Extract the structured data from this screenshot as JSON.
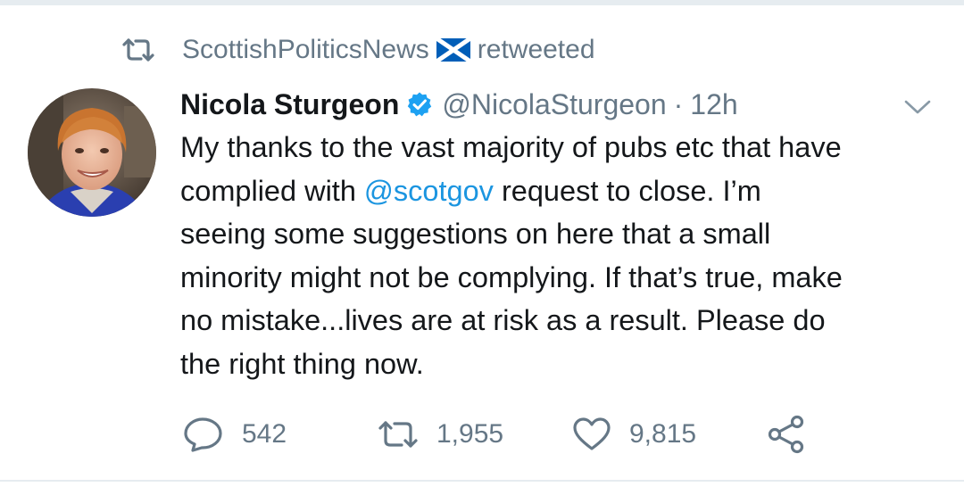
{
  "social_context": {
    "retweeter": "ScottishPoliticsNews",
    "action": "retweeted"
  },
  "tweet": {
    "author": {
      "display_name": "Nicola Sturgeon",
      "handle": "@NicolaSturgeon",
      "verified": true
    },
    "separator": "·",
    "timestamp": "12h",
    "text_lines": [
      {
        "text": "My thanks to the vast majority of pubs etc that have"
      },
      {
        "before": "complied with ",
        "mention": "@scotgov",
        "after": " request to close. I’m"
      },
      {
        "text": "seeing some suggestions on here that a small"
      },
      {
        "text": "minority might not be complying. If that’s true, make"
      },
      {
        "text": "no mistake...lives are at risk as a result. Please do"
      },
      {
        "text": "the right thing now."
      }
    ]
  },
  "actions": {
    "reply_count": "542",
    "retweet_count": "1,955",
    "like_count": "9,815"
  },
  "colors": {
    "text_primary": "#14171a",
    "text_secondary": "#657786",
    "link_blue": "#1b95e0",
    "verified_blue": "#1da1f2",
    "divider": "#e6ecf0",
    "saltire_blue": "#005eb8"
  },
  "icons": {
    "social_context": "retweet-icon",
    "flag": "saltire-flag-icon",
    "verified": "verified-badge-icon",
    "menu": "chevron-down-icon",
    "reply": "reply-icon",
    "retweet": "retweet-icon",
    "like": "heart-icon",
    "share": "share-icon"
  }
}
